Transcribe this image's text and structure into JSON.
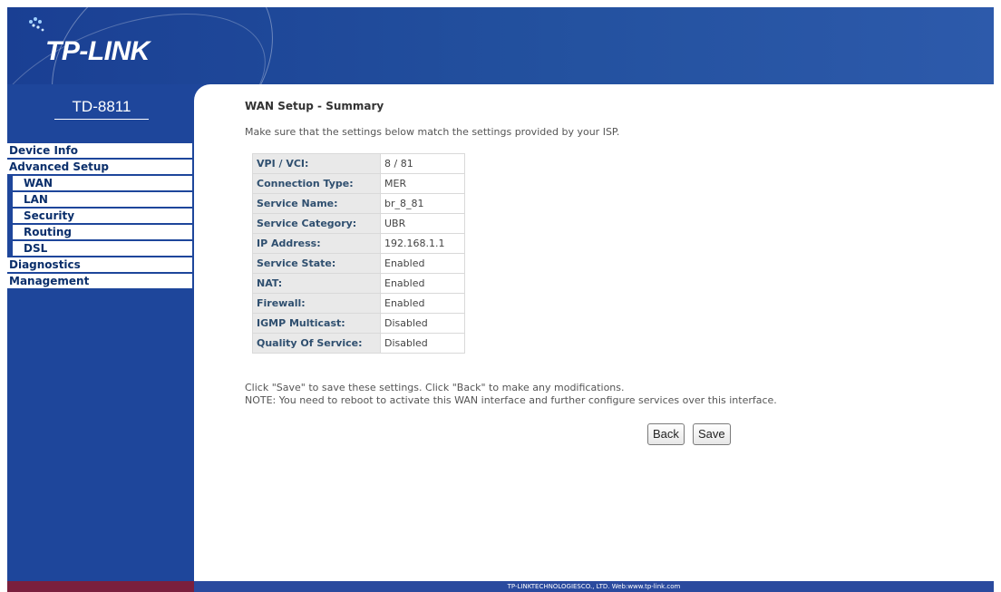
{
  "brand": {
    "logo_text": "TP-LINK",
    "model": "TD-8811"
  },
  "menu": {
    "items": [
      {
        "label": "Device Info",
        "sub": false
      },
      {
        "label": "Advanced Setup",
        "sub": false
      },
      {
        "label": "WAN",
        "sub": true
      },
      {
        "label": "LAN",
        "sub": true
      },
      {
        "label": "Security",
        "sub": true
      },
      {
        "label": "Routing",
        "sub": true
      },
      {
        "label": "DSL",
        "sub": true
      },
      {
        "label": "Diagnostics",
        "sub": false
      },
      {
        "label": "Management",
        "sub": false
      }
    ]
  },
  "page": {
    "title": "WAN Setup - Summary",
    "intro": "Make sure that the settings below match the settings provided by your ISP.",
    "summary": [
      {
        "label": "VPI / VCI:",
        "value": "8 / 81"
      },
      {
        "label": "Connection Type:",
        "value": "MER"
      },
      {
        "label": "Service Name:",
        "value": "br_8_81"
      },
      {
        "label": "Service Category:",
        "value": "UBR"
      },
      {
        "label": "IP Address:",
        "value": "192.168.1.1"
      },
      {
        "label": "Service State:",
        "value": "Enabled"
      },
      {
        "label": "NAT:",
        "value": "Enabled"
      },
      {
        "label": "Firewall:",
        "value": "Enabled"
      },
      {
        "label": "IGMP Multicast:",
        "value": "Disabled"
      },
      {
        "label": "Quality Of Service:",
        "value": "Disabled"
      }
    ],
    "note_line1": "Click \"Save\" to save these settings. Click \"Back\" to make any modifications.",
    "note_line2": "NOTE: You need to reboot to activate this WAN interface and further configure services over this interface.",
    "back_label": "Back",
    "save_label": "Save"
  },
  "footer": {
    "text": "TP-LINKTECHNOLOGIESCO., LTD. Web:www.tp-link.com"
  },
  "colors": {
    "brand_blue": "#1e469b",
    "menu_text": "#0b2f6b",
    "label_bg": "#e9e9e9"
  }
}
